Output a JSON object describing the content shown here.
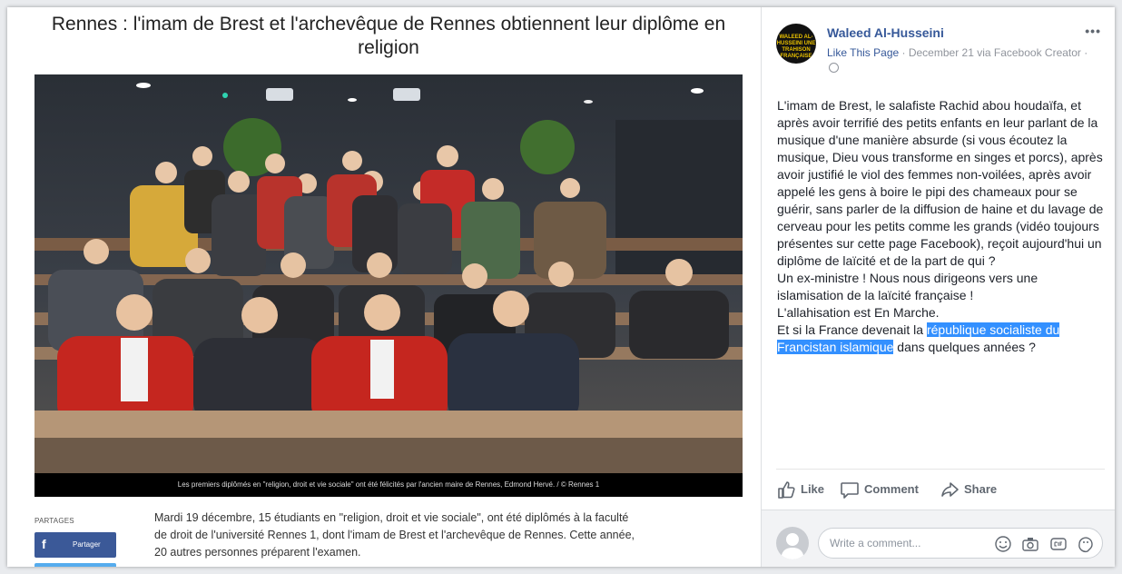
{
  "article": {
    "title": "Rennes : l'imam de Brest et l'archevêque de Rennes obtiennent leur diplôme en religion",
    "caption": "Les premiers diplômés en \"religion, droit et vie sociale\" ont été félicités par l'ancien maire de Rennes, Edmond Hervé. / © Rennes 1",
    "partages_label": "PARTAGES",
    "share_button": "Partager",
    "body": "Mardi 19 décembre, 15 étudiants en \"religion, droit et vie sociale\", ont été diplômés à la faculté de droit de l'université Rennes 1, dont l'imam de Brest et l'archevêque de Rennes. Cette année, 20 autres personnes préparent l'examen."
  },
  "post": {
    "author": "Waleed Al-Husseini",
    "avatar_text": "WALEED AL-HUSSEINI UNE TRAHISON FRANÇAISE",
    "like_page": "Like This Page",
    "meta_rest": " · December 21 via Facebook Creator · ",
    "text_main": "L'imam de Brest, le salafiste Rachid abou houdaïfa, et après avoir terrifié des petits enfants en leur parlant de la musique d'une manière absurde (si vous écoutez la musique, Dieu vous transforme en singes et porcs), après avoir justifié le viol des femmes non-voilées, après avoir appelé les gens à boire le pipi des chameaux pour se guérir, sans parler de la diffusion de haine et du lavage de cerveau pour les petits comme les grands (vidéo toujours présentes sur cette page Facebook), reçoit aujourd'hui un diplôme de laïcité et de la part de qui ?",
    "text_line2": "Un ex-ministre ! Nous nous dirigeons vers une islamisation de la laïcité française !",
    "text_line3": "L'allahisation est En Marche.",
    "text_line4_before": "Et si la France devenait la ",
    "text_line4_highlight": "république socialiste du Francistan islamique",
    "text_line4_after": " dans quelques années ?",
    "more": "•••"
  },
  "actions": {
    "like": "Like",
    "comment": "Comment",
    "share": "Share"
  },
  "comment_box": {
    "placeholder": "Write a comment..."
  },
  "colors": {
    "link": "#365899",
    "highlight": "#3390ff",
    "facebook": "#3b5998"
  }
}
